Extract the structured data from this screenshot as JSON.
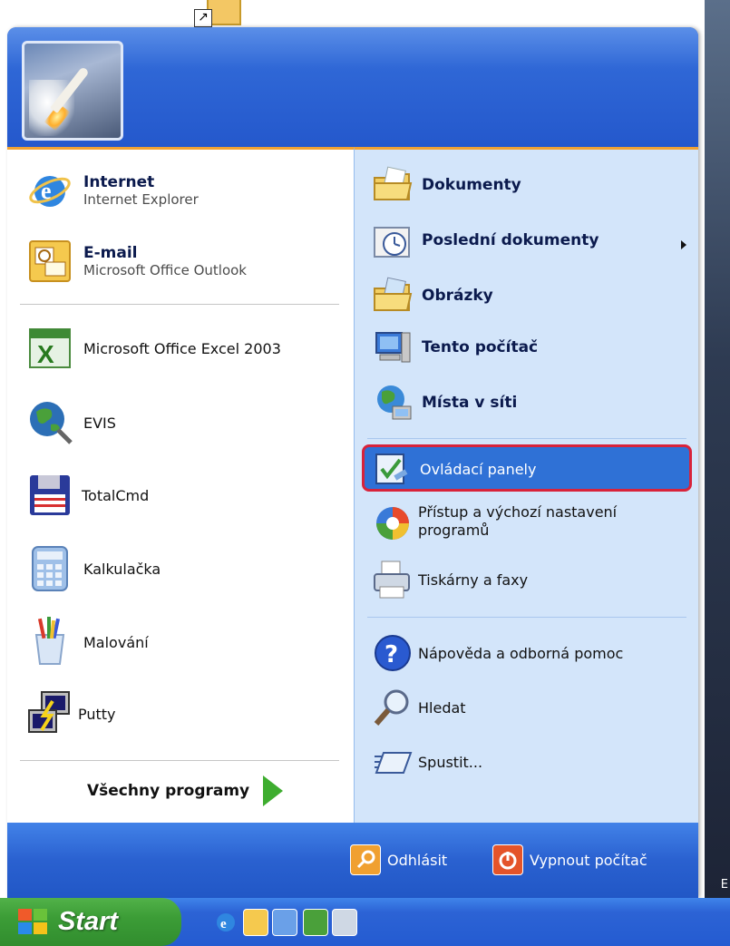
{
  "left_panel": {
    "pinned": [
      {
        "title": "Internet",
        "subtitle": "Internet Explorer",
        "icon": "internet-explorer-icon"
      },
      {
        "title": "E-mail",
        "subtitle": "Microsoft Office Outlook",
        "icon": "outlook-icon"
      }
    ],
    "recent": [
      {
        "label": "Microsoft Office Excel 2003",
        "icon": "excel-icon"
      },
      {
        "label": "EVIS",
        "icon": "globe-plug-icon"
      },
      {
        "label": "TotalCmd",
        "icon": "floppy-icon"
      },
      {
        "label": "Kalkulačka",
        "icon": "calculator-icon"
      },
      {
        "label": "Malování",
        "icon": "paint-icon"
      },
      {
        "label": "Putty",
        "icon": "putty-icon"
      }
    ],
    "all_programs": "Všechny programy"
  },
  "right_panel": {
    "items": [
      {
        "label": "Dokumenty"
      },
      {
        "label": "Poslední dokumenty"
      },
      {
        "label": "Obrázky"
      },
      {
        "label": "Tento počítač"
      },
      {
        "label": "Místa v síti"
      },
      {
        "label": "Ovládací panely"
      },
      {
        "label": "Přístup a výchozí nastavení",
        "label2": "programů"
      },
      {
        "label": "Tiskárny a faxy"
      },
      {
        "label": "Nápověda a odborná pomoc"
      },
      {
        "label": "Hledat"
      },
      {
        "label": "Spustit..."
      }
    ]
  },
  "footer": {
    "logoff": "Odhlásit",
    "shutdown": "Vypnout počítač"
  },
  "taskbar": {
    "start_label": "Start"
  },
  "desktop": {
    "text": "E"
  },
  "colors": {
    "highlight": "#2f71d6",
    "highlight_border": "#d8233b",
    "accent_orange": "#f0a233"
  }
}
